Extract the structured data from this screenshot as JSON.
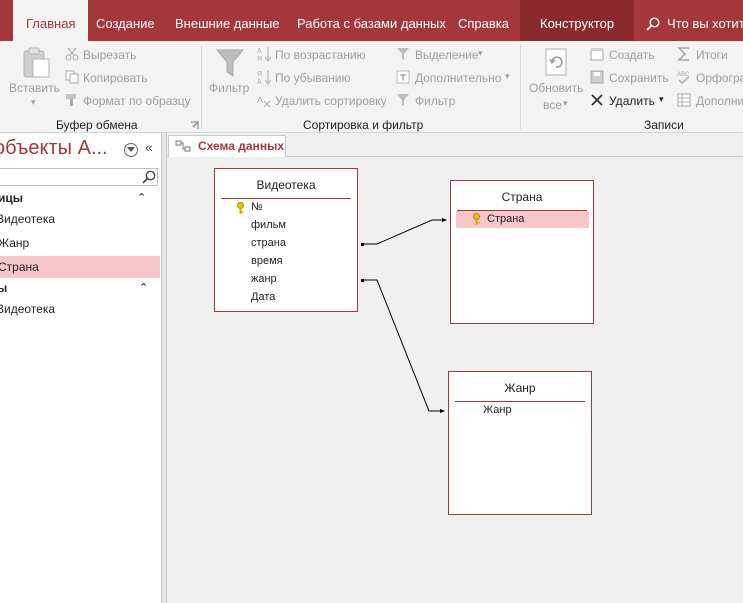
{
  "ribbon_tabs": {
    "home": "Главная",
    "create": "Создание",
    "external_data": "Внешние данные",
    "database_tools": "Работа с базами данных",
    "help": "Справка",
    "design": "Конструктор",
    "tell_me": "Что вы хотите"
  },
  "clipboard": {
    "paste": "Вставить",
    "cut": "Вырезать",
    "copy": "Копировать",
    "format_painter": "Формат по образцу",
    "group_label": "Буфер обмена"
  },
  "sort_filter": {
    "filter": "Фильтр",
    "ascending": "По возрастанию",
    "descending": "По убыванию",
    "remove_sort": "Удалить сортировку",
    "selection": "Выделение",
    "advanced": "Дополнительно",
    "toggle_filter": "Фильтр",
    "group_label": "Сортировка и фильтр"
  },
  "records": {
    "refresh_all_line1": "Обновить",
    "refresh_all_line2": "все",
    "new": "Создать",
    "save": "Сохранить",
    "delete": "Удалить",
    "totals": "Итоги",
    "spelling": "Орфогра",
    "more": "Дополни",
    "group_label": "Записи"
  },
  "nav_pane": {
    "title": "объекты А...",
    "groups": [
      {
        "label": "ицы",
        "items": [
          "Видеотека",
          "Жанр",
          "Страна"
        ]
      },
      {
        "label": "ы",
        "items": [
          "Видеотека"
        ]
      }
    ],
    "selected_item": "Страна"
  },
  "doc_tab": {
    "label": "Схема данных"
  },
  "relationships": {
    "tables": [
      {
        "name": "Видеотека",
        "fields": [
          "№",
          "фильм",
          "страна",
          "время",
          "жанр",
          "Дата"
        ],
        "key_field": "№"
      },
      {
        "name": "Страна",
        "fields": [
          "Страна"
        ],
        "key_field": "Страна",
        "selected_field": "Страна"
      },
      {
        "name": "Жанр",
        "fields": [
          "Жанр"
        ],
        "key_field": ""
      }
    ],
    "links": [
      {
        "from": "Видеотека.страна",
        "to": "Страна.Страна"
      },
      {
        "from": "Видеотека.жанр",
        "to": "Жанр.Жанр"
      }
    ]
  },
  "colors": {
    "accent": "#a4373a",
    "selection": "#f7c6c8",
    "canvas": "#f0f0f0",
    "ribbon": "#f3f3f3"
  },
  "icons": [
    "search-icon",
    "paste-icon",
    "cut-icon",
    "copy-icon",
    "format-painter-icon",
    "funnel-icon",
    "sort-ascending-icon",
    "sort-descending-icon",
    "remove-sort-icon",
    "refresh-icon",
    "new-record-icon",
    "save-record-icon",
    "delete-icon",
    "totals-icon",
    "spelling-icon",
    "key-icon",
    "relationships-icon"
  ]
}
